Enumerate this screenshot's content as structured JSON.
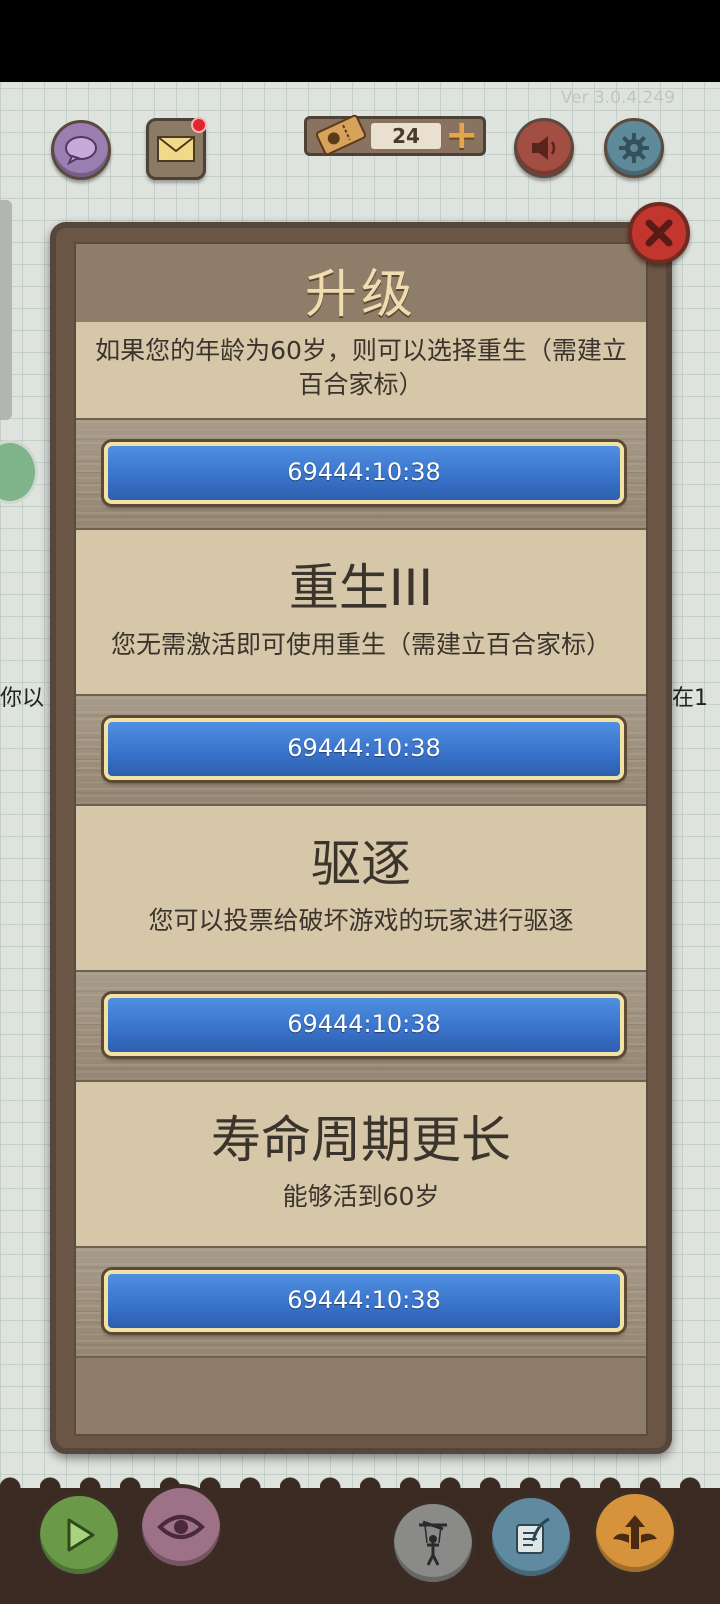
{
  "header": {
    "version": "Ver 3.0.4.249",
    "tickets": "24"
  },
  "background": {
    "left_text": "你以",
    "right_text": "在1"
  },
  "dialog": {
    "title": "升级",
    "items": [
      {
        "name": "",
        "description": "如果您的年龄为60岁，则可以选择重生（需建立百合家标）",
        "button": "69444:10:38"
      },
      {
        "name": "重生III",
        "description": "您无需激活即可使用重生（需建立百合家标）",
        "button": "69444:10:38"
      },
      {
        "name": "驱逐",
        "description": "您可以投票给破坏游戏的玩家进行驱逐",
        "button": "69444:10:38"
      },
      {
        "name": "寿命周期更长",
        "description": "能够活到60岁",
        "button": "69444:10:38"
      }
    ]
  },
  "icons": {
    "chat": "chat-bubble-icon",
    "mail": "mail-icon",
    "ticket": "ticket-icon",
    "add": "plus-icon",
    "sound": "speaker-icon",
    "settings": "gear-icon",
    "close": "close-icon",
    "play": "play-icon",
    "eye": "eye-icon",
    "puppet": "puppet-icon",
    "scroll": "scroll-quill-icon",
    "upgrade": "winged-arrow-icon"
  },
  "colors": {
    "button_blue": "#3a74cc",
    "panel_brown": "#6b5646",
    "card_beige": "#d6c7a9",
    "title_gold": "#f0dcae"
  }
}
